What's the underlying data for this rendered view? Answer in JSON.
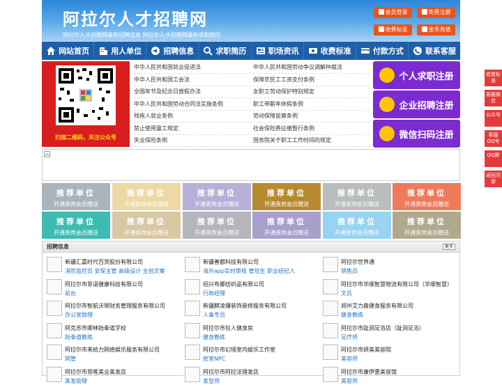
{
  "header": {
    "logo": "阿拉尔人才招聘网",
    "slogan": "阿拉尔人才招聘网最新招聘信息   阿拉尔人才招聘网最新求职简历",
    "buttons": [
      "会员登录",
      "免费注册",
      "收费标准",
      "金币充值"
    ]
  },
  "nav": [
    "网站首页",
    "用人单位",
    "招聘信息",
    "求职简历",
    "职场资讯",
    "收费标准",
    "付款方式",
    "联系客服"
  ],
  "qr_caption": "扫描二维码，关注公众号",
  "laws": [
    [
      "中华人民共和国就业促进法",
      "中华人民共和国劳动争议调解仲裁法"
    ],
    [
      "中华人民共和国工会法",
      "保障农民工工资支付条例"
    ],
    [
      "全国年节及纪念日放假办法",
      "女职工劳动保护特别规定"
    ],
    [
      "中华人民共和国劳动合同法实施条例",
      "职工带薪年休假条例"
    ],
    [
      "残疾人就业条例",
      "劳动保障监察条例"
    ],
    [
      "禁止使用童工规定",
      "社会保险费征缴暂行条例"
    ],
    [
      "失业保险条例",
      "国务院关于职工工作时间的规定"
    ]
  ],
  "register": [
    "个人求职注册",
    "企业招聘注册",
    "微信扫码注册"
  ],
  "tiles": {
    "title": "推荐单位",
    "sub": "开通贵宾会员赠送",
    "colors": [
      "#a8b6bc",
      "#eed9a4",
      "#b4b0d8",
      "#b88a2f",
      "#b9bdbd",
      "#ef7a5a",
      "#3cbcb2",
      "#d8c8a4",
      "#b4b6bc",
      "#a5a0cc",
      "#97d3f2",
      "#b1a98e"
    ]
  },
  "jobs": {
    "title": "招聘信息",
    "more": "更多",
    "columns": [
      [
        {
          "company": "新疆汇嘉时代百货股份有限公司",
          "positions": "消防监控员 安保主管 高级设计 主创文案"
        },
        {
          "company": "阿拉尔市思语健康科技有限公司",
          "positions": "前台"
        },
        {
          "company": "阿拉尔市智航沃顿财务管理服务有限公司",
          "positions": "办公室助理"
        },
        {
          "company": "阿克苏市卿林跆拳道学校",
          "positions": "跆拳道教练"
        },
        {
          "company": "阿拉尔市来给力网络娱乐服务有限公司",
          "positions": "网管"
        },
        {
          "company": "阿拉尔市思唯美业美发店",
          "positions": "美发助理"
        }
      ],
      [
        {
          "company": "新疆善都科技有限公司",
          "positions": "海外app实时审核 管培生 职业经纪人"
        },
        {
          "company": "绍兴布娜纺织品有限公司",
          "positions": "行政经理"
        },
        {
          "company": "新疆麒凌爆装饰装修服务有限公司",
          "positions": "人事专员"
        },
        {
          "company": "阿拉尔市狂人健身房",
          "positions": "健身教练"
        },
        {
          "company": "阿拉尔市幻境室内娱乐工作室",
          "positions": "密室NPC"
        },
        {
          "company": "阿拉尔市阿拉法理发店",
          "positions": "发型师"
        }
      ],
      [
        {
          "company": "阿拉尔世界通",
          "positions": "销售员"
        },
        {
          "company": "阿拉尔市华顺智慧物流有限公司（华顺智慧）",
          "positions": "文员"
        },
        {
          "company": "郑州艾力森健身服务有限公司",
          "positions": "健身教练"
        },
        {
          "company": "阿拉尔市趾洞足浴店（趾洞足浴）",
          "positions": "足疗师"
        },
        {
          "company": "阿拉尔市妍美美容院",
          "positions": "美容师"
        },
        {
          "company": "阿拉尔市康伊惠美容馆",
          "positions": "美容师"
        }
      ]
    ]
  },
  "side": [
    "收费标准",
    "客服微信",
    "公众号",
    "客服QQ号",
    "QQ群",
    "返回顶部"
  ]
}
